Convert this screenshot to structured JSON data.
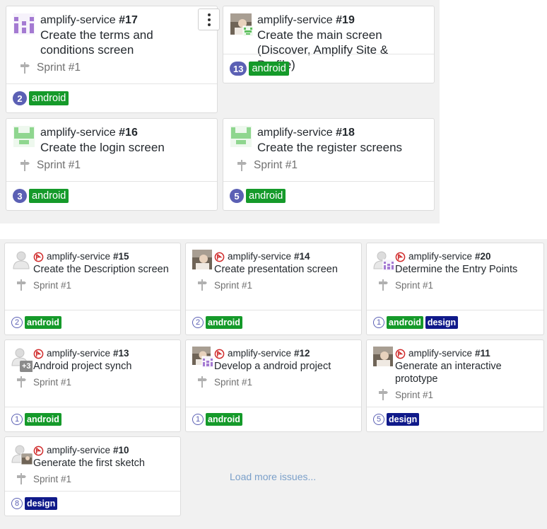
{
  "repo": "amplify-service",
  "sprint": "Sprint #1",
  "top_cards": [
    {
      "number": "#17",
      "title": "Create the terms and conditions screen",
      "count": "2",
      "labels": [
        "android"
      ],
      "avatar": "identicon-purple"
    },
    {
      "number": "#19",
      "title": "Create the main screen (Discover, Amplify Site & Profile)",
      "count": "13",
      "labels": [
        "android"
      ],
      "avatar": "photo-with-green-identicon"
    },
    {
      "number": "#16",
      "title": "Create the login screen",
      "count": "3",
      "labels": [
        "android"
      ],
      "avatar": "identicon-green"
    },
    {
      "number": "#18",
      "title": "Create the register screens",
      "count": "5",
      "labels": [
        "android"
      ],
      "avatar": "identicon-green"
    }
  ],
  "bottom_cards": [
    {
      "number": "#15",
      "title": "Create the Description screen",
      "count": "2",
      "labels": [
        "android"
      ],
      "avatar": "default-user"
    },
    {
      "number": "#14",
      "title": "Create presentation screen",
      "count": "2",
      "labels": [
        "android"
      ],
      "avatar": "photo"
    },
    {
      "number": "#20",
      "title": "Determine the Entry Points",
      "count": "1",
      "labels": [
        "android",
        "design"
      ],
      "avatar": "default-user-with-purple-identicon"
    },
    {
      "number": "#13",
      "title": "Android project synch",
      "count": "1",
      "labels": [
        "android"
      ],
      "avatar": "default-user-plus",
      "avatar_extra": "+3"
    },
    {
      "number": "#12",
      "title": "Develop a android project",
      "count": "1",
      "labels": [
        "android"
      ],
      "avatar": "photo-with-purple-identicon"
    },
    {
      "number": "#11",
      "title": "Generate an interactive prototype",
      "count": "5",
      "labels": [
        "design"
      ],
      "avatar": "photo"
    },
    {
      "number": "#10",
      "title": "Generate the first sketch",
      "count": "8",
      "labels": [
        "design"
      ],
      "avatar": "default-user-with-photo"
    }
  ],
  "load_more": "Load more issues...",
  "colors": {
    "android": "#159a2a",
    "design": "#101a8a",
    "count": "#5b60b4",
    "epic": "#d02b2b"
  }
}
